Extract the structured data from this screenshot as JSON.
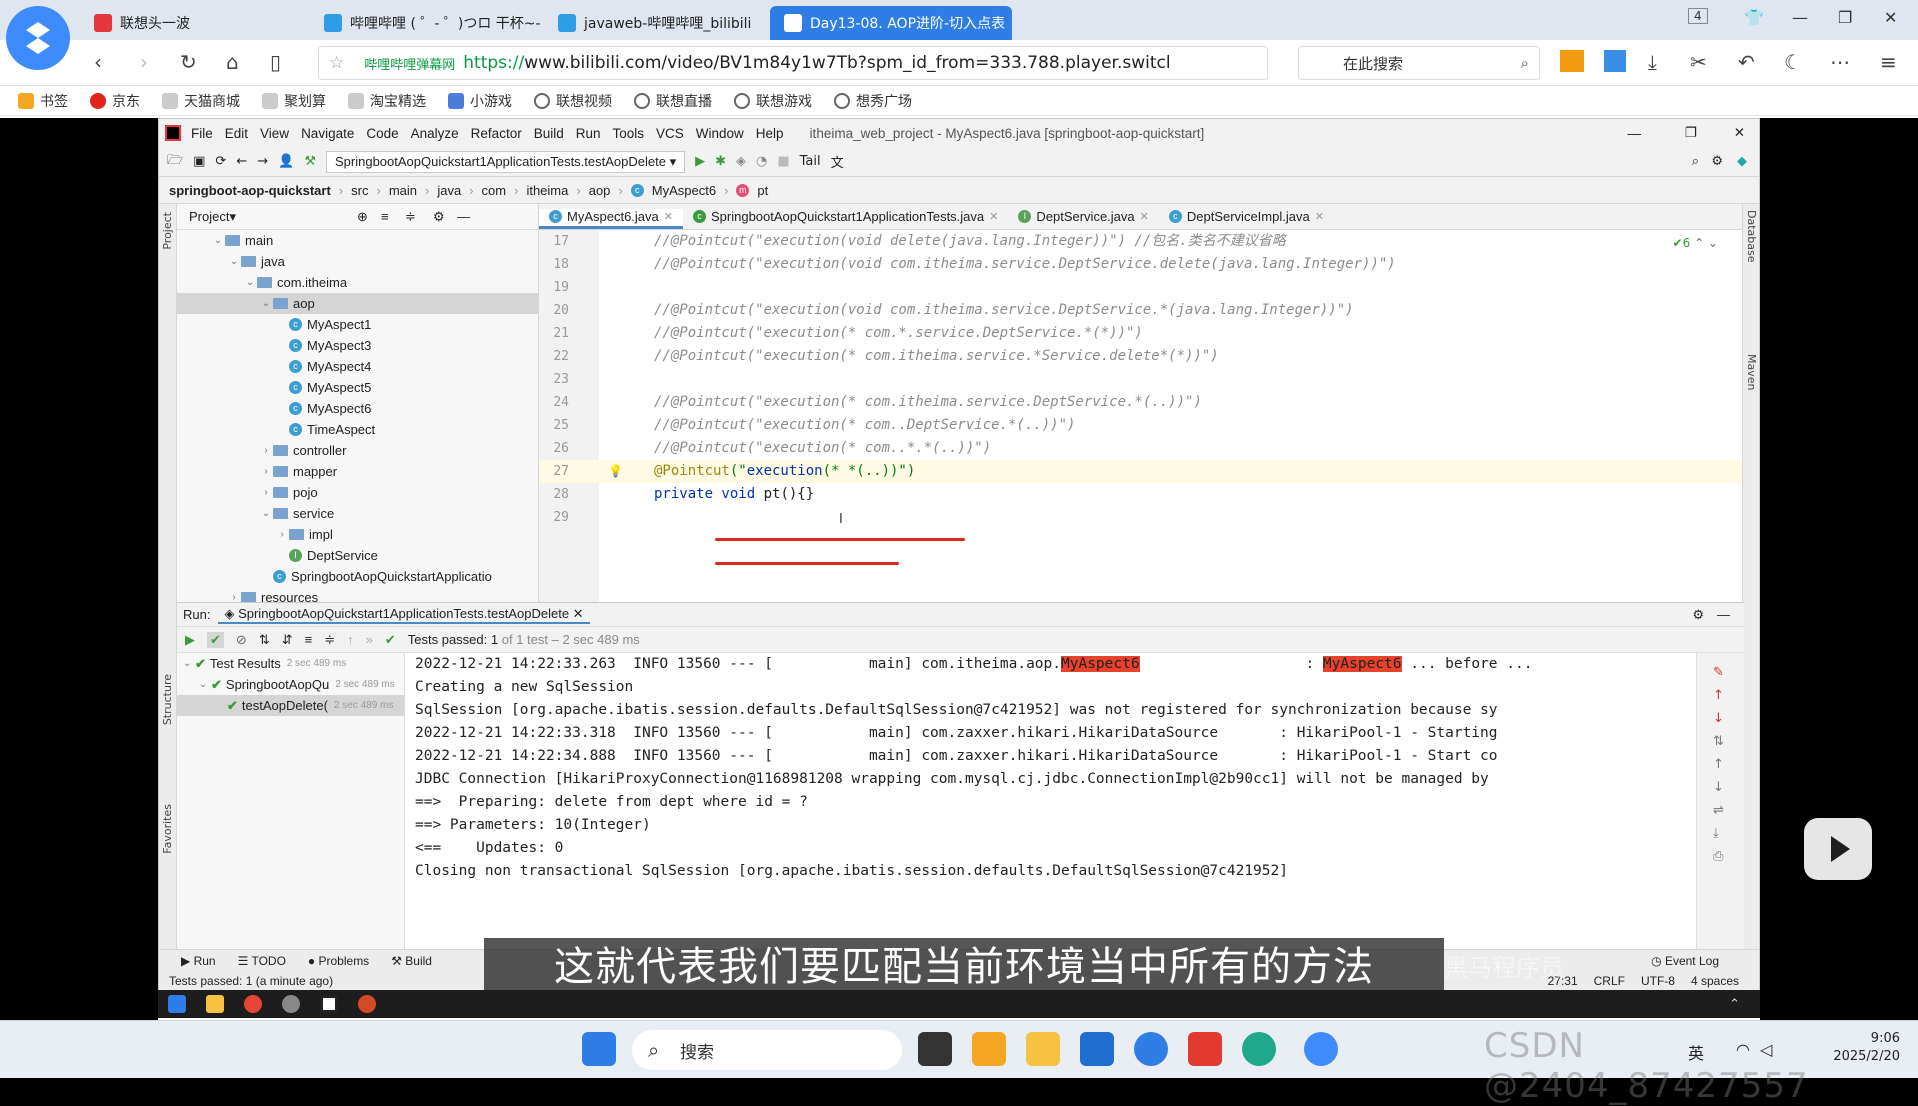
{
  "browser": {
    "tabs": [
      {
        "label": "联想头一波",
        "color": "#e2383b"
      },
      {
        "label": "哔哩哔哩 ( ゜- ゜)つロ 干杯~-bilib",
        "color": "#2f9de6"
      },
      {
        "label": "javaweb-哔哩哔哩_bilibili",
        "color": "#2f9de6"
      },
      {
        "label": "Day13-08. AOP进阶-切入点表",
        "color": "#2f9de6"
      }
    ],
    "tab_count": "4",
    "url_site": "哔哩哔哩弹幕网",
    "url_https": "https://",
    "url_rest": "www.bilibili.com/video/BV1m84y1w7Tb?spm_id_from=333.788.player.switcl",
    "search_placeholder": "在此搜索",
    "bookmarks": [
      "书签",
      "京东",
      "天猫商城",
      "聚划算",
      "淘宝精选",
      "小游戏",
      "联想视频",
      "联想直播",
      "联想游戏",
      "想秀广场"
    ]
  },
  "ide": {
    "menu": [
      "File",
      "Edit",
      "View",
      "Navigate",
      "Code",
      "Analyze",
      "Refactor",
      "Build",
      "Run",
      "Tools",
      "VCS",
      "Window",
      "Help"
    ],
    "title": "itheima_web_project - MyAspect6.java [springboot-aop-quickstart]",
    "run_config": "SpringbootAopQuickstart1ApplicationTests.testAopDelete",
    "tail_label": "Tail",
    "breadcrumb": [
      "springboot-aop-quickstart",
      "src",
      "main",
      "java",
      "com",
      "itheima",
      "aop",
      "MyAspect6",
      "pt"
    ],
    "project_label": "Project",
    "tree": [
      {
        "label": "main",
        "depth": 1,
        "type": "folder",
        "open": true
      },
      {
        "label": "java",
        "depth": 2,
        "type": "folder",
        "open": true
      },
      {
        "label": "com.itheima",
        "depth": 3,
        "type": "folder",
        "open": true
      },
      {
        "label": "aop",
        "depth": 4,
        "type": "folder",
        "open": true,
        "selected": true
      },
      {
        "label": "MyAspect1",
        "depth": 5,
        "type": "class"
      },
      {
        "label": "MyAspect3",
        "depth": 5,
        "type": "class"
      },
      {
        "label": "MyAspect4",
        "depth": 5,
        "type": "class"
      },
      {
        "label": "MyAspect5",
        "depth": 5,
        "type": "class"
      },
      {
        "label": "MyAspect6",
        "depth": 5,
        "type": "class"
      },
      {
        "label": "TimeAspect",
        "depth": 5,
        "type": "class"
      },
      {
        "label": "controller",
        "depth": 4,
        "type": "folder",
        "open": false
      },
      {
        "label": "mapper",
        "depth": 4,
        "type": "folder",
        "open": false
      },
      {
        "label": "pojo",
        "depth": 4,
        "type": "folder",
        "open": false
      },
      {
        "label": "service",
        "depth": 4,
        "type": "folder",
        "open": true
      },
      {
        "label": "impl",
        "depth": 5,
        "type": "folder",
        "open": false
      },
      {
        "label": "DeptService",
        "depth": 5,
        "type": "interface"
      },
      {
        "label": "SpringbootAopQuickstartApplicatio",
        "depth": 4,
        "type": "class"
      },
      {
        "label": "resources",
        "depth": 2,
        "type": "folder",
        "open": false
      }
    ],
    "editor_tabs": [
      {
        "label": "MyAspect6.java",
        "active": true
      },
      {
        "label": "SpringbootAopQuickstart1ApplicationTests.java",
        "active": false
      },
      {
        "label": "DeptService.java",
        "active": false
      },
      {
        "label": "DeptServiceImpl.java",
        "active": false
      }
    ],
    "inspection_count": "6",
    "code_lines": [
      {
        "n": "17",
        "kind": "comment",
        "text": "//@Pointcut(\"execution(void delete(java.lang.Integer))\") //包名.类名不建议省略"
      },
      {
        "n": "18",
        "kind": "comment",
        "text": "//@Pointcut(\"execution(void com.itheima.service.DeptService.delete(java.lang.Integer))\")"
      },
      {
        "n": "19",
        "kind": "blank",
        "text": ""
      },
      {
        "n": "20",
        "kind": "comment",
        "text": "//@Pointcut(\"execution(void com.itheima.service.DeptService.*(java.lang.Integer))\")"
      },
      {
        "n": "21",
        "kind": "comment",
        "text": "//@Pointcut(\"execution(* com.*.service.DeptService.*(*))\")"
      },
      {
        "n": "22",
        "kind": "comment",
        "text": "//@Pointcut(\"execution(* com.itheima.service.*Service.delete*(*))\")"
      },
      {
        "n": "23",
        "kind": "blank",
        "text": ""
      },
      {
        "n": "24",
        "kind": "comment",
        "text": "//@Pointcut(\"execution(* com.itheima.service.DeptService.*(..))\")"
      },
      {
        "n": "25",
        "kind": "comment",
        "text": "//@Pointcut(\"execution(* com..DeptService.*(..))\")"
      },
      {
        "n": "26",
        "kind": "comment",
        "text": "//@Pointcut(\"execution(* com..*.*(..))\")"
      },
      {
        "n": "27",
        "kind": "pointcut",
        "ann": "@Pointcut",
        "pre": "(\"",
        "str": "execution",
        "post": "(* *(..))\")"
      },
      {
        "n": "28",
        "kind": "method",
        "kw": "private void",
        "text": " pt(){}"
      },
      {
        "n": "29",
        "kind": "blank",
        "text": ""
      }
    ],
    "run": {
      "label": "Run:",
      "config": "SpringbootAopQuickstart1ApplicationTests.testAopDelete",
      "summary_prefix": "Tests passed:",
      "summary_count": "1",
      "summary_rest": "of 1 test – 2 sec 489 ms",
      "tests": [
        {
          "label": "Test Results",
          "time": "2 sec 489 ms",
          "depth": 0
        },
        {
          "label": "SpringbootAopQu",
          "time": "2 sec 489 ms",
          "depth": 1
        },
        {
          "label": "testAopDelete(",
          "time": "2 sec 489 ms",
          "depth": 2
        }
      ],
      "console": [
        {
          "pre": "2022-12-21 14:22:33.263  INFO 13560 --- [           main] com.itheima.aop.",
          "hl": "MyAspect6",
          "mid": "                   : ",
          "hl2": "MyAspect6",
          "post": " ... before ..."
        },
        {
          "pre": "Creating a new SqlSession"
        },
        {
          "pre": "SqlSession [org.apache.ibatis.session.defaults.DefaultSqlSession@7c421952] was not registered for synchronization because sy"
        },
        {
          "pre": "2022-12-21 14:22:33.318  INFO 13560 --- [           main] com.zaxxer.hikari.HikariDataSource       : HikariPool-1 - Starting"
        },
        {
          "pre": "2022-12-21 14:22:34.888  INFO 13560 --- [           main] com.zaxxer.hikari.HikariDataSource       : HikariPool-1 - Start co"
        },
        {
          "pre": "JDBC Connection [HikariProxyConnection@1168981208 wrapping com.mysql.cj.jdbc.ConnectionImpl@2b90cc1] will not be managed by"
        },
        {
          "pre": "==>  Preparing: delete from dept where id = ?"
        },
        {
          "pre": "==> Parameters: 10(Integer)"
        },
        {
          "pre": "<==    Updates: 0"
        },
        {
          "pre": "Closing non transactional SqlSession [org.apache.ibatis.session.defaults.DefaultSqlSession@7c421952]"
        }
      ]
    },
    "bottom_tabs": [
      "Run",
      "TODO",
      "Problems",
      "Build"
    ],
    "event_log": "Event Log",
    "status": "Tests passed: 1 (a minute ago)",
    "status_right": [
      "27:31",
      "CRLF",
      "UTF-8",
      "4 spaces"
    ]
  },
  "subtitle": "这就代表我们要匹配当前环境当中所有的方法",
  "watermark": "黑马程序员",
  "taskbar": {
    "search": "搜索",
    "time": "9:06",
    "date": "2025/2/20",
    "ime": "英"
  },
  "csdn_watermark": "CSDN @2404_87427557"
}
